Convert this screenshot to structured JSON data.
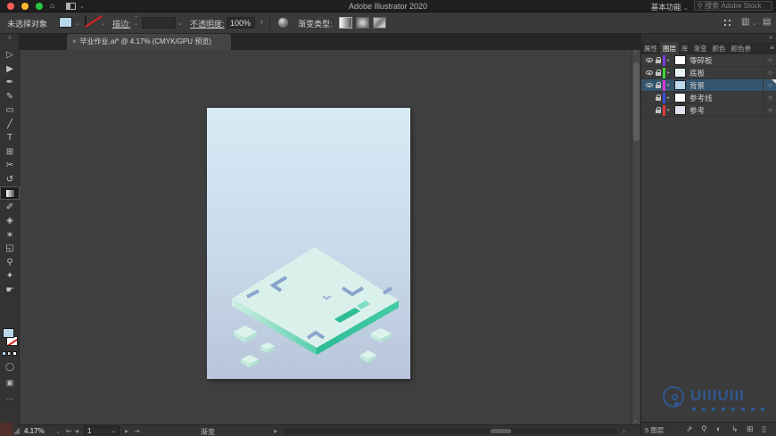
{
  "titlebar": {
    "title": "Adobe Illustrator 2020",
    "workspace": "基本功能",
    "search_placeholder": "搜索 Adobe Stock"
  },
  "controlbar": {
    "selection_status": "未选择对象",
    "stroke_label": "描边:",
    "opacity_label": "不透明度:",
    "opacity_value": "100%",
    "gradient_type_label": "渐变类型:",
    "fill_color": "#b9d7ea"
  },
  "tabbar": {
    "close_glyph": "×",
    "document_title": "毕业作业.ai* @ 4.17% (CMYK/GPU 预览)"
  },
  "toolbar": {
    "selected_tool": "gradient-tool",
    "tools": [
      {
        "name": "selection-tool",
        "glyph": "▷"
      },
      {
        "name": "direct-selection-tool",
        "glyph": "▶"
      },
      {
        "name": "pen-tool",
        "glyph": "✒"
      },
      {
        "name": "curvature-tool",
        "glyph": "✎"
      },
      {
        "name": "rectangle-tool",
        "glyph": "▭"
      },
      {
        "name": "line-segment-tool",
        "glyph": "╱"
      },
      {
        "name": "type-tool",
        "glyph": "T"
      },
      {
        "name": "artboard-tool",
        "glyph": "⊞"
      },
      {
        "name": "scissors-tool",
        "glyph": "✂"
      },
      {
        "name": "rotate-tool",
        "glyph": "↺"
      },
      {
        "name": "gradient-tool",
        "glyph": "",
        "selected": true
      },
      {
        "name": "eyedropper-tool",
        "glyph": "✐"
      },
      {
        "name": "blend-tool",
        "glyph": "◈"
      },
      {
        "name": "symbol-sprayer-tool",
        "glyph": "∗"
      },
      {
        "name": "shape-builder-tool",
        "glyph": "◱"
      },
      {
        "name": "zoom-tool",
        "glyph": "⚲"
      },
      {
        "name": "width-tool",
        "glyph": "✦"
      },
      {
        "name": "hand-tool",
        "glyph": "☛"
      }
    ]
  },
  "layers_panel": {
    "tabs": [
      {
        "label": "属性",
        "active": false
      },
      {
        "label": "图层",
        "active": true
      },
      {
        "label": "库",
        "active": false
      },
      {
        "label": "渐变",
        "active": false
      },
      {
        "label": "颜色",
        "active": false
      },
      {
        "label": "颜色参",
        "active": false
      }
    ],
    "footer_count": "5 图层",
    "footer_icons": [
      {
        "name": "collect-for-export-icon",
        "glyph": "⇗"
      },
      {
        "name": "locate-object-icon",
        "glyph": "⚲"
      },
      {
        "name": "make-clip-mask-icon",
        "glyph": "◐"
      },
      {
        "name": "new-sublayer-icon",
        "glyph": "↳"
      },
      {
        "name": "new-layer-icon",
        "glyph": "⊞"
      },
      {
        "name": "delete-selection-icon",
        "glyph": "▯"
      }
    ]
  },
  "layers": [
    {
      "name": "零碎板",
      "color": "#7a3be0",
      "visible": true,
      "locked": true,
      "selected": false,
      "thumb": "#ffffff"
    },
    {
      "name": "底板",
      "color": "#3fd435",
      "visible": true,
      "locked": true,
      "selected": false,
      "thumb": "#e8f3fa"
    },
    {
      "name": "背景",
      "color": "#d438d4",
      "visible": true,
      "locked": true,
      "selected": true,
      "thumb": "#bcd9ec"
    },
    {
      "name": "参考线",
      "color": "#3550e0",
      "visible": false,
      "locked": true,
      "selected": false,
      "thumb": "#ffffff"
    },
    {
      "name": "参考",
      "color": "#e03a3a",
      "visible": false,
      "locked": true,
      "selected": false,
      "thumb": "#dfe2ee"
    }
  ],
  "statusbar": {
    "zoom": "4.17%",
    "artboard_number": "1",
    "tool_status": "渐变"
  },
  "watermark": {
    "text": "UIIIUIII",
    "color": "#2d5da0"
  },
  "artboard": {
    "colors": {
      "bg_top": "#d7eaf5",
      "bg_bottom": "#b8c5da",
      "platform_top": "#d9f1ea",
      "platform_left_start": "#d3efe6",
      "platform_left_end": "#54cdaa",
      "platform_right": "#3cc7a2",
      "notch_teal": "#2bbd96",
      "bracket_blue": "#8aa5cc",
      "tile_top": "#dcf3ec",
      "tile_left": "#c3e8dc",
      "tile_right": "#b2e0d2"
    }
  }
}
